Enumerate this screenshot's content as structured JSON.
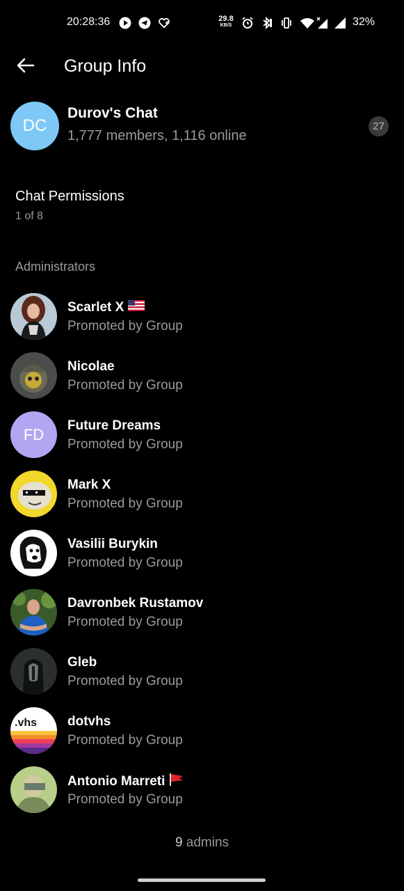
{
  "status_bar": {
    "time": "20:28:36",
    "net_speed_value": "29.8",
    "net_speed_unit": "KB/S",
    "battery": "32%"
  },
  "toolbar": {
    "title": "Group Info",
    "back_icon": "arrow-left-icon"
  },
  "group": {
    "initials": "DC",
    "name": "Durov's Chat",
    "subtitle": "1,777 members, 1,116 online",
    "badge_count": "27",
    "avatar_color": "#7ec8f5"
  },
  "permissions": {
    "title": "Chat Permissions",
    "value": "1 of 8"
  },
  "admins_header": "Administrators",
  "admins": [
    {
      "name": "Scarlet X",
      "role": "Promoted by Group",
      "flag": "us-flag",
      "avatar": "photo"
    },
    {
      "name": "Nicolae",
      "role": "Promoted by Group",
      "avatar": "photo"
    },
    {
      "name": "Future Dreams",
      "role": "Promoted by Group",
      "avatar": "initials",
      "initials": "FD",
      "avatar_color": "#b3a5f2"
    },
    {
      "name": "Mark X",
      "role": "Promoted by Group",
      "avatar": "photo"
    },
    {
      "name": "Vasilii Burykin",
      "role": "Promoted by Group",
      "avatar": "photo"
    },
    {
      "name": "Davronbek Rustamov",
      "role": "Promoted by Group",
      "avatar": "photo"
    },
    {
      "name": "Gleb",
      "role": "Promoted by Group",
      "avatar": "photo"
    },
    {
      "name": "dotvhs",
      "role": "Promoted by Group",
      "avatar": "logo",
      "logo_text": ".vhs"
    },
    {
      "name": "Antonio Marreti",
      "role": "Promoted by Group",
      "flag": "red-flag",
      "avatar": "photo"
    }
  ],
  "footer": {
    "count": "9",
    "label": "admins"
  }
}
